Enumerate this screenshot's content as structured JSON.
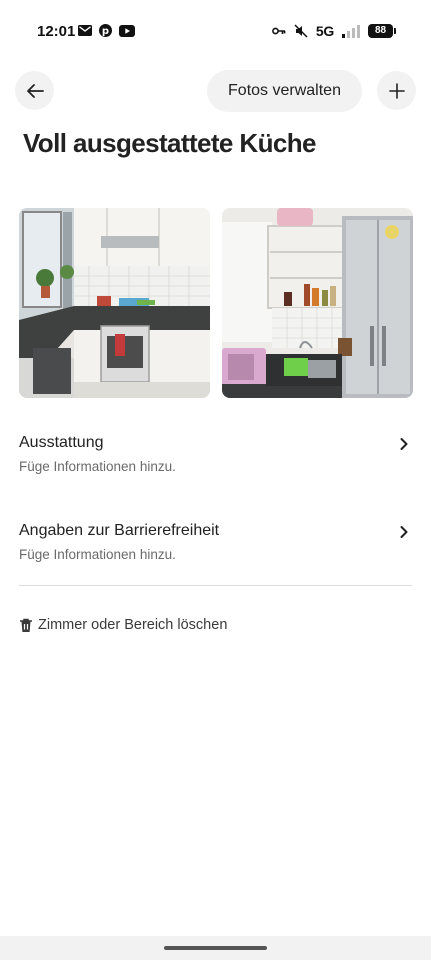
{
  "status_bar": {
    "time": "12:01",
    "left_icons": [
      "gmail-icon",
      "pinterest-icon",
      "youtube-icon"
    ],
    "network": "5G",
    "battery": "88",
    "right_icons": [
      "key-icon",
      "mute-icon",
      "signal-icon"
    ]
  },
  "header": {
    "manage_photos_label": "Fotos verwalten",
    "back_icon": "arrow-left-icon",
    "add_icon": "plus-icon"
  },
  "page": {
    "title": "Voll ausgestattete Küche"
  },
  "photos": [
    {
      "name": "kitchen-photo-1"
    },
    {
      "name": "kitchen-photo-2"
    }
  ],
  "rows": [
    {
      "title": "Ausstattung",
      "subtitle": "Füge Informationen hinzu."
    },
    {
      "title": "Angaben zur Barrierefreiheit",
      "subtitle": "Füge Informationen hinzu."
    }
  ],
  "delete": {
    "label": "Zimmer oder Bereich löschen",
    "icon": "trash-icon"
  },
  "colors": {
    "text": "#222222",
    "secondary_text": "#6a6a6a",
    "button_bg": "#f2f2f2",
    "divider": "#dddddd"
  }
}
